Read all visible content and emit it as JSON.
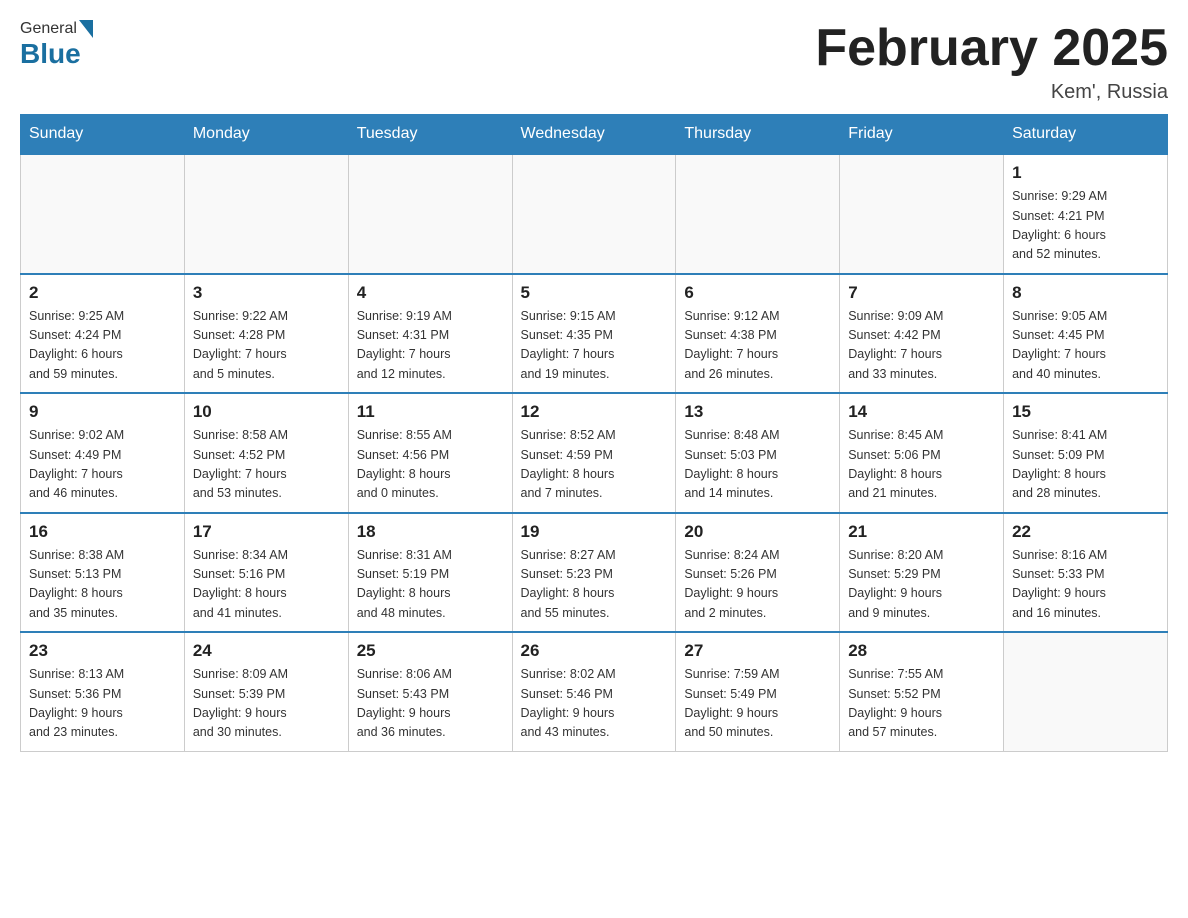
{
  "header": {
    "logo_general": "General",
    "logo_blue": "Blue",
    "month_title": "February 2025",
    "location": "Kem', Russia"
  },
  "weekdays": [
    "Sunday",
    "Monday",
    "Tuesday",
    "Wednesday",
    "Thursday",
    "Friday",
    "Saturday"
  ],
  "weeks": [
    [
      {
        "day": "",
        "info": ""
      },
      {
        "day": "",
        "info": ""
      },
      {
        "day": "",
        "info": ""
      },
      {
        "day": "",
        "info": ""
      },
      {
        "day": "",
        "info": ""
      },
      {
        "day": "",
        "info": ""
      },
      {
        "day": "1",
        "info": "Sunrise: 9:29 AM\nSunset: 4:21 PM\nDaylight: 6 hours\nand 52 minutes."
      }
    ],
    [
      {
        "day": "2",
        "info": "Sunrise: 9:25 AM\nSunset: 4:24 PM\nDaylight: 6 hours\nand 59 minutes."
      },
      {
        "day": "3",
        "info": "Sunrise: 9:22 AM\nSunset: 4:28 PM\nDaylight: 7 hours\nand 5 minutes."
      },
      {
        "day": "4",
        "info": "Sunrise: 9:19 AM\nSunset: 4:31 PM\nDaylight: 7 hours\nand 12 minutes."
      },
      {
        "day": "5",
        "info": "Sunrise: 9:15 AM\nSunset: 4:35 PM\nDaylight: 7 hours\nand 19 minutes."
      },
      {
        "day": "6",
        "info": "Sunrise: 9:12 AM\nSunset: 4:38 PM\nDaylight: 7 hours\nand 26 minutes."
      },
      {
        "day": "7",
        "info": "Sunrise: 9:09 AM\nSunset: 4:42 PM\nDaylight: 7 hours\nand 33 minutes."
      },
      {
        "day": "8",
        "info": "Sunrise: 9:05 AM\nSunset: 4:45 PM\nDaylight: 7 hours\nand 40 minutes."
      }
    ],
    [
      {
        "day": "9",
        "info": "Sunrise: 9:02 AM\nSunset: 4:49 PM\nDaylight: 7 hours\nand 46 minutes."
      },
      {
        "day": "10",
        "info": "Sunrise: 8:58 AM\nSunset: 4:52 PM\nDaylight: 7 hours\nand 53 minutes."
      },
      {
        "day": "11",
        "info": "Sunrise: 8:55 AM\nSunset: 4:56 PM\nDaylight: 8 hours\nand 0 minutes."
      },
      {
        "day": "12",
        "info": "Sunrise: 8:52 AM\nSunset: 4:59 PM\nDaylight: 8 hours\nand 7 minutes."
      },
      {
        "day": "13",
        "info": "Sunrise: 8:48 AM\nSunset: 5:03 PM\nDaylight: 8 hours\nand 14 minutes."
      },
      {
        "day": "14",
        "info": "Sunrise: 8:45 AM\nSunset: 5:06 PM\nDaylight: 8 hours\nand 21 minutes."
      },
      {
        "day": "15",
        "info": "Sunrise: 8:41 AM\nSunset: 5:09 PM\nDaylight: 8 hours\nand 28 minutes."
      }
    ],
    [
      {
        "day": "16",
        "info": "Sunrise: 8:38 AM\nSunset: 5:13 PM\nDaylight: 8 hours\nand 35 minutes."
      },
      {
        "day": "17",
        "info": "Sunrise: 8:34 AM\nSunset: 5:16 PM\nDaylight: 8 hours\nand 41 minutes."
      },
      {
        "day": "18",
        "info": "Sunrise: 8:31 AM\nSunset: 5:19 PM\nDaylight: 8 hours\nand 48 minutes."
      },
      {
        "day": "19",
        "info": "Sunrise: 8:27 AM\nSunset: 5:23 PM\nDaylight: 8 hours\nand 55 minutes."
      },
      {
        "day": "20",
        "info": "Sunrise: 8:24 AM\nSunset: 5:26 PM\nDaylight: 9 hours\nand 2 minutes."
      },
      {
        "day": "21",
        "info": "Sunrise: 8:20 AM\nSunset: 5:29 PM\nDaylight: 9 hours\nand 9 minutes."
      },
      {
        "day": "22",
        "info": "Sunrise: 8:16 AM\nSunset: 5:33 PM\nDaylight: 9 hours\nand 16 minutes."
      }
    ],
    [
      {
        "day": "23",
        "info": "Sunrise: 8:13 AM\nSunset: 5:36 PM\nDaylight: 9 hours\nand 23 minutes."
      },
      {
        "day": "24",
        "info": "Sunrise: 8:09 AM\nSunset: 5:39 PM\nDaylight: 9 hours\nand 30 minutes."
      },
      {
        "day": "25",
        "info": "Sunrise: 8:06 AM\nSunset: 5:43 PM\nDaylight: 9 hours\nand 36 minutes."
      },
      {
        "day": "26",
        "info": "Sunrise: 8:02 AM\nSunset: 5:46 PM\nDaylight: 9 hours\nand 43 minutes."
      },
      {
        "day": "27",
        "info": "Sunrise: 7:59 AM\nSunset: 5:49 PM\nDaylight: 9 hours\nand 50 minutes."
      },
      {
        "day": "28",
        "info": "Sunrise: 7:55 AM\nSunset: 5:52 PM\nDaylight: 9 hours\nand 57 minutes."
      },
      {
        "day": "",
        "info": ""
      }
    ]
  ]
}
